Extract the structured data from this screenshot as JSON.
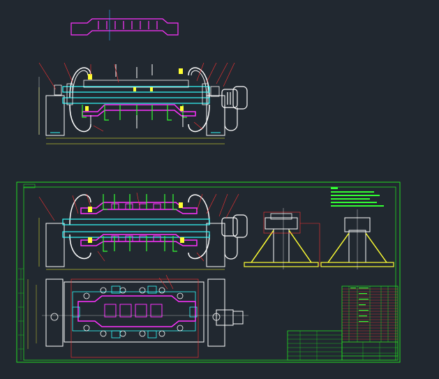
{
  "drawing": {
    "background": "#212830",
    "colors": {
      "frame": "#22dd22",
      "outline": "#ffffff",
      "part": "#ff22ff",
      "pipe": "#33ffff",
      "accent": "#ffff33",
      "dim": "#ff3333",
      "weld": "#33ff33"
    },
    "title_block_icon": "table-grid-icon",
    "note_icon": "text-notes-icon"
  }
}
